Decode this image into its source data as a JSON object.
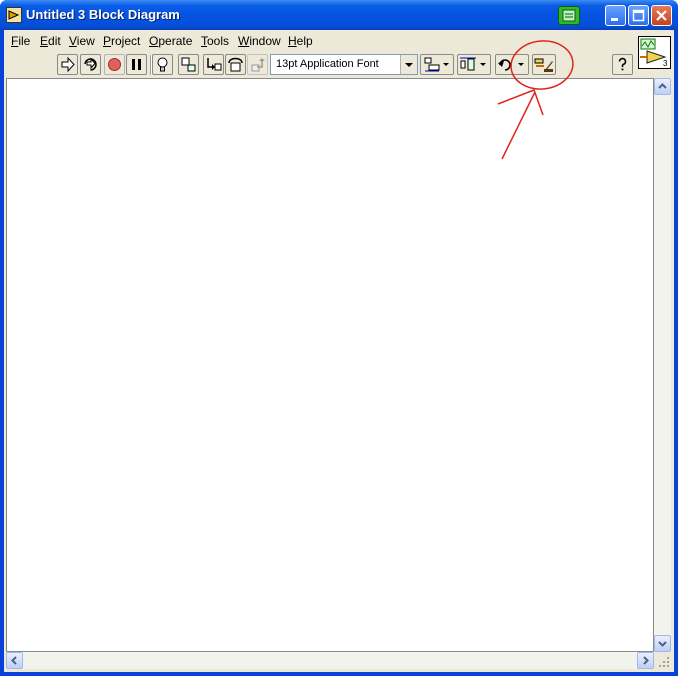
{
  "window": {
    "title": "Untitled 3 Block Diagram",
    "controls": [
      "minimize-icon",
      "maximize-icon",
      "close-icon"
    ]
  },
  "menubar": {
    "items": [
      {
        "prefix": "",
        "mnemonic": "F",
        "rest": "ile"
      },
      {
        "prefix": "",
        "mnemonic": "E",
        "rest": "dit"
      },
      {
        "prefix": "",
        "mnemonic": "V",
        "rest": "iew"
      },
      {
        "prefix": "",
        "mnemonic": "P",
        "rest": "roject"
      },
      {
        "prefix": "",
        "mnemonic": "O",
        "rest": "perate"
      },
      {
        "prefix": "",
        "mnemonic": "T",
        "rest": "ools"
      },
      {
        "prefix": "",
        "mnemonic": "W",
        "rest": "indow"
      },
      {
        "prefix": "",
        "mnemonic": "H",
        "rest": "elp"
      }
    ]
  },
  "toolbar": {
    "font_value": "13pt Application Font",
    "vi_icon_number": "3",
    "buttons": [
      "run-arrow-icon",
      "run-continuously-icon",
      "abort-execution-icon",
      "pause-icon",
      "highlight-execution-lightbulb-icon",
      "retain-wire-values-icon",
      "step-into-icon",
      "step-over-icon",
      "step-out-icon",
      "align-objects-icon",
      "distribute-objects-icon",
      "reorder-icon",
      "clean-up-diagram-icon",
      "context-help-icon"
    ]
  },
  "colors": {
    "titlebar": "#0553e1",
    "client": "#ece9d8",
    "annotation": "#e0241c",
    "run_indicator": "#2fb82f"
  }
}
